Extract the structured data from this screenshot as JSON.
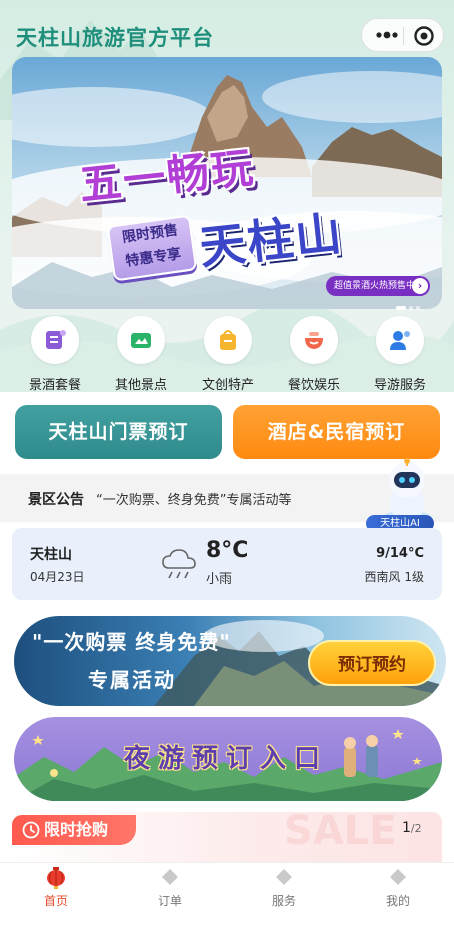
{
  "header": {
    "title": "天柱山旅游官方平台"
  },
  "banner": {
    "headline_line1": "五一畅玩",
    "headline_line2": "天柱山",
    "tag_line1": "限时预售",
    "tag_line2": "特惠专享",
    "chip_text": "超值景酒火热预售中"
  },
  "categories": [
    {
      "label": "景酒套餐",
      "icon": "hotel-package-icon"
    },
    {
      "label": "其他景点",
      "icon": "scenic-ticket-icon"
    },
    {
      "label": "文创特产",
      "icon": "gift-bag-icon"
    },
    {
      "label": "餐饮娱乐",
      "icon": "dining-icon"
    },
    {
      "label": "导游服务",
      "icon": "guide-icon"
    }
  ],
  "actions": {
    "ticket_label": "天柱山门票预订",
    "hotel_label": "酒店&民宿预订"
  },
  "notice": {
    "label": "景区公告",
    "text": "“一次购票、终身免费”专属活动等"
  },
  "assistant": {
    "label": "天柱山AI"
  },
  "weather": {
    "location": "天柱山",
    "date": "04月23日",
    "temperature": "8°C",
    "condition": "小雨",
    "range": "9/14°C",
    "wind": "西南风 1级"
  },
  "promo1": {
    "line1": "\"一次购票  终身免费\"",
    "line2": "专属活动",
    "button": "预订预约"
  },
  "promo2": {
    "text": "夜游预订入口"
  },
  "flash_sale": {
    "label": "限时抢购",
    "page_current": "1",
    "page_total": "/2",
    "bg_word": "SALE"
  },
  "tabbar": [
    {
      "label": "首页",
      "active": true
    },
    {
      "label": "订单",
      "active": false
    },
    {
      "label": "服务",
      "active": false
    },
    {
      "label": "我的",
      "active": false
    }
  ],
  "colors": {
    "brand_teal": "#2f8b8c",
    "brand_orange": "#ff8a10",
    "active_tab": "#e84a2c"
  }
}
